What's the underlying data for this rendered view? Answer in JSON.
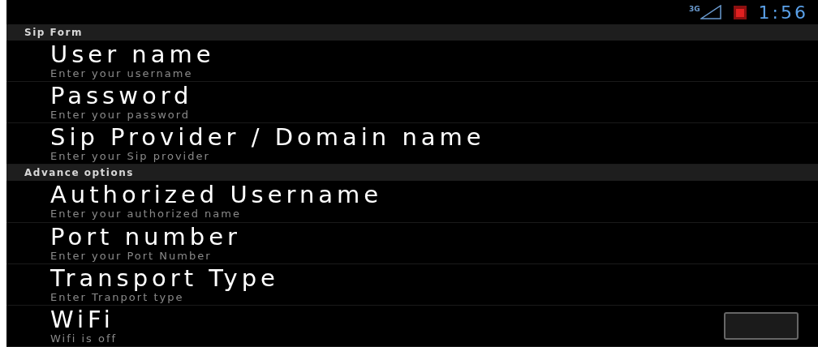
{
  "status_bar": {
    "network": "3G",
    "time": "1:56"
  },
  "sections": [
    {
      "header": "Sip Form",
      "items": [
        {
          "kind": "text",
          "title": "User name",
          "summary": "Enter your username"
        },
        {
          "kind": "text",
          "title": "Password",
          "summary": "Enter your password"
        },
        {
          "kind": "text",
          "title": "Sip Provider / Domain name",
          "summary": "Enter your Sip provider"
        }
      ]
    },
    {
      "header": "Advance options",
      "items": [
        {
          "kind": "text",
          "title": "Authorized Username",
          "summary": "Enter your authorized name"
        },
        {
          "kind": "text",
          "title": "Port number",
          "summary": "Enter your Port Number"
        },
        {
          "kind": "text",
          "title": "Transport Type",
          "summary": "Enter Tranport type"
        },
        {
          "kind": "checkbox",
          "title": "WiFi",
          "summary": "Wifi is off",
          "checked": false
        }
      ]
    }
  ]
}
